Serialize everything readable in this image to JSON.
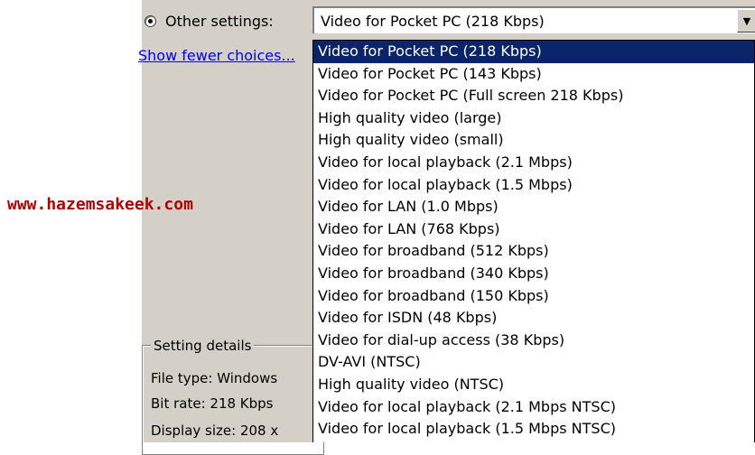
{
  "watermark": "www.hazemsakeek.com",
  "radio": {
    "label": "Other settings:",
    "selected": true
  },
  "combo": {
    "value": "Video for Pocket PC (218 Kbps)"
  },
  "link": "Show fewer choices...",
  "setting_details": {
    "title": "Setting details",
    "file_type": "File type: Windows",
    "bit_rate": "Bit rate: 218 Kbps",
    "display_size": "Display size: 208 x"
  },
  "dropdown": {
    "options": [
      "Video for Pocket PC (218 Kbps)",
      "Video for Pocket PC (143 Kbps)",
      "Video for Pocket PC (Full screen 218 Kbps)",
      "High quality video (large)",
      "High quality video (small)",
      "Video for local playback (2.1 Mbps)",
      "Video for local playback (1.5 Mbps)",
      "Video for LAN (1.0 Mbps)",
      "Video for LAN (768 Kbps)",
      "Video for broadband (512 Kbps)",
      "Video for broadband (340 Kbps)",
      "Video for broadband (150 Kbps)",
      "Video for ISDN (48 Kbps)",
      "Video for dial-up access (38 Kbps)",
      "DV-AVI (NTSC)",
      "High quality video (NTSC)",
      "Video for local playback (2.1 Mbps NTSC)",
      "Video for local playback (1.5 Mbps NTSC)"
    ],
    "selected_index": 0
  },
  "colors": {
    "highlight": "#0a246a",
    "dialog": "#d4d0c8",
    "watermark": "#b00000",
    "link": "#0000ff"
  }
}
